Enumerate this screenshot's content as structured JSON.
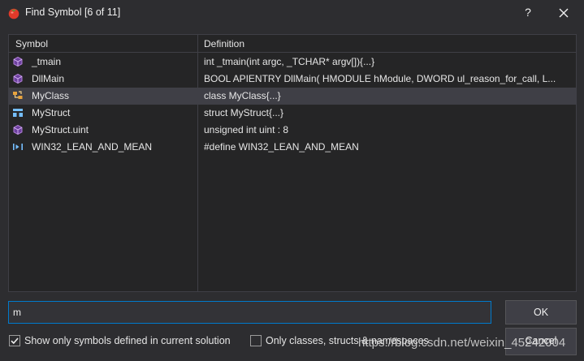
{
  "window": {
    "title": "Find Symbol [6 of 11]",
    "help_label": "?",
    "icons": {
      "app": "tomato-icon",
      "close": "close-icon"
    }
  },
  "columns": {
    "symbol": "Symbol",
    "definition": "Definition"
  },
  "rows": [
    {
      "symbol": "_tmain",
      "definition": "int _tmain(int argc, _TCHAR* argv[]){...}",
      "icon": "function-icon",
      "selected": false
    },
    {
      "symbol": "DllMain",
      "definition": "BOOL APIENTRY DllMain( HMODULE hModule, DWORD ul_reason_for_call, L...",
      "icon": "function-icon",
      "selected": false
    },
    {
      "symbol": "MyClass",
      "definition": "class MyClass{...}",
      "icon": "class-icon",
      "selected": true
    },
    {
      "symbol": "MyStruct",
      "definition": "struct MyStruct{...}",
      "icon": "struct-icon",
      "selected": false
    },
    {
      "symbol": "MyStruct.uint",
      "definition": "unsigned int uint : 8",
      "icon": "field-icon",
      "selected": false
    },
    {
      "symbol": "WIN32_LEAN_AND_MEAN",
      "definition": "#define WIN32_LEAN_AND_MEAN",
      "icon": "macro-icon",
      "selected": false
    }
  ],
  "search": {
    "value": "m"
  },
  "buttons": {
    "ok": "OK",
    "cancel": "Cancel"
  },
  "options": {
    "only_current_solution": {
      "label": "Show only symbols defined in current solution",
      "checked": true
    },
    "only_classes": {
      "label": "Only classes, structs & namespaces",
      "checked": false
    }
  },
  "watermark": "https://blog.csdn.net/weixin_45242004",
  "colors": {
    "background": "#2d2d30",
    "list_bg": "#252526",
    "selected_row": "#3f3f46",
    "accent_border": "#007acc",
    "function_icon": "#b180d7",
    "struct_icon": "#75beff"
  }
}
